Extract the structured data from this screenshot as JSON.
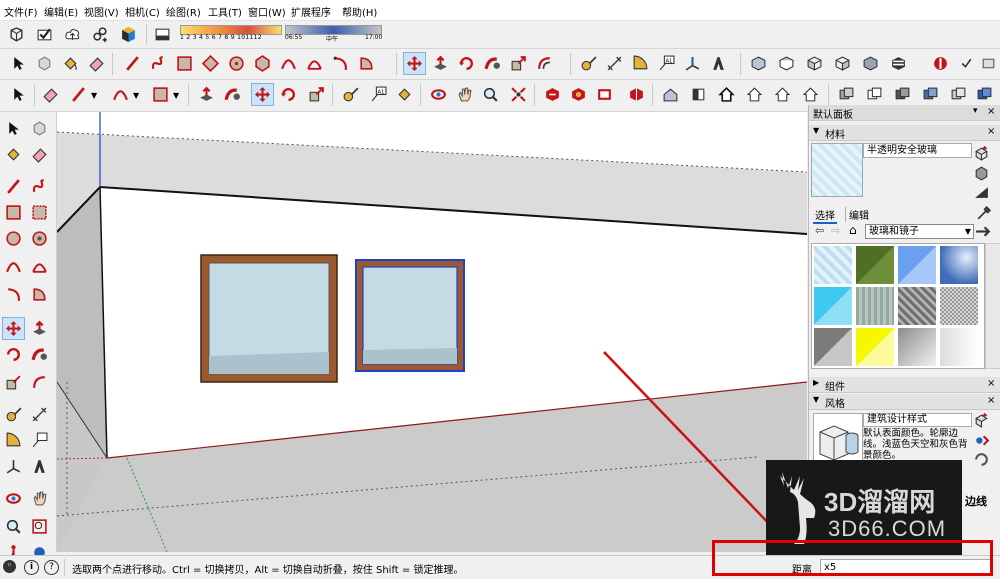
{
  "menu": {
    "items": [
      "文件(F)",
      "编辑(E)",
      "视图(V)",
      "相机(C)",
      "绘图(R)",
      "工具(T)",
      "窗口(W)",
      "扩展程序",
      "帮助(H)"
    ]
  },
  "shadow_bar": {
    "months": [
      "1",
      "2",
      "3",
      "4",
      "5",
      "6",
      "7",
      "8",
      "9",
      "10",
      "11",
      "12"
    ],
    "time_start": "06:55",
    "time_mid": "中午",
    "time_end": "17:00"
  },
  "tray": {
    "title": "默认面板",
    "materials": {
      "header": "材料",
      "material_name": "半透明安全玻璃",
      "tab_select": "选择",
      "tab_edit": "编辑",
      "library": "玻璃和镜子",
      "swatch_colors": [
        "#bcdff0",
        "#4f6f25",
        "#7aaef5",
        "#3f6db8",
        "#3fc8f0",
        "#93a89e",
        "#8a8a8a",
        "#c9c9c9",
        "#7c7c7c",
        "#f7f700",
        "#a8a8a8",
        "#dcdcdc"
      ]
    },
    "components": {
      "header": "组件"
    },
    "styles": {
      "header": "风格",
      "style_name": "建筑设计样式",
      "description": "默认表面颜色。轮廓边线。浅蓝色天空和灰色背景颜色。",
      "edge_label": "边线"
    }
  },
  "status": {
    "message": "选取两个点进行移动。Ctrl = 切换拷贝，Alt = 切换自动折叠，按住 Shift = 锁定推理。",
    "vcb_label": "距离",
    "vcb_value": "x5"
  },
  "watermark": {
    "line1": "3D溜溜网",
    "line2": "3D66.COM"
  },
  "colors": {
    "accent_blue": "#1f5fbf",
    "frame_brown": "#9b5a2d",
    "glass": "#c4dbe3",
    "highlight_red": "#e00000"
  }
}
